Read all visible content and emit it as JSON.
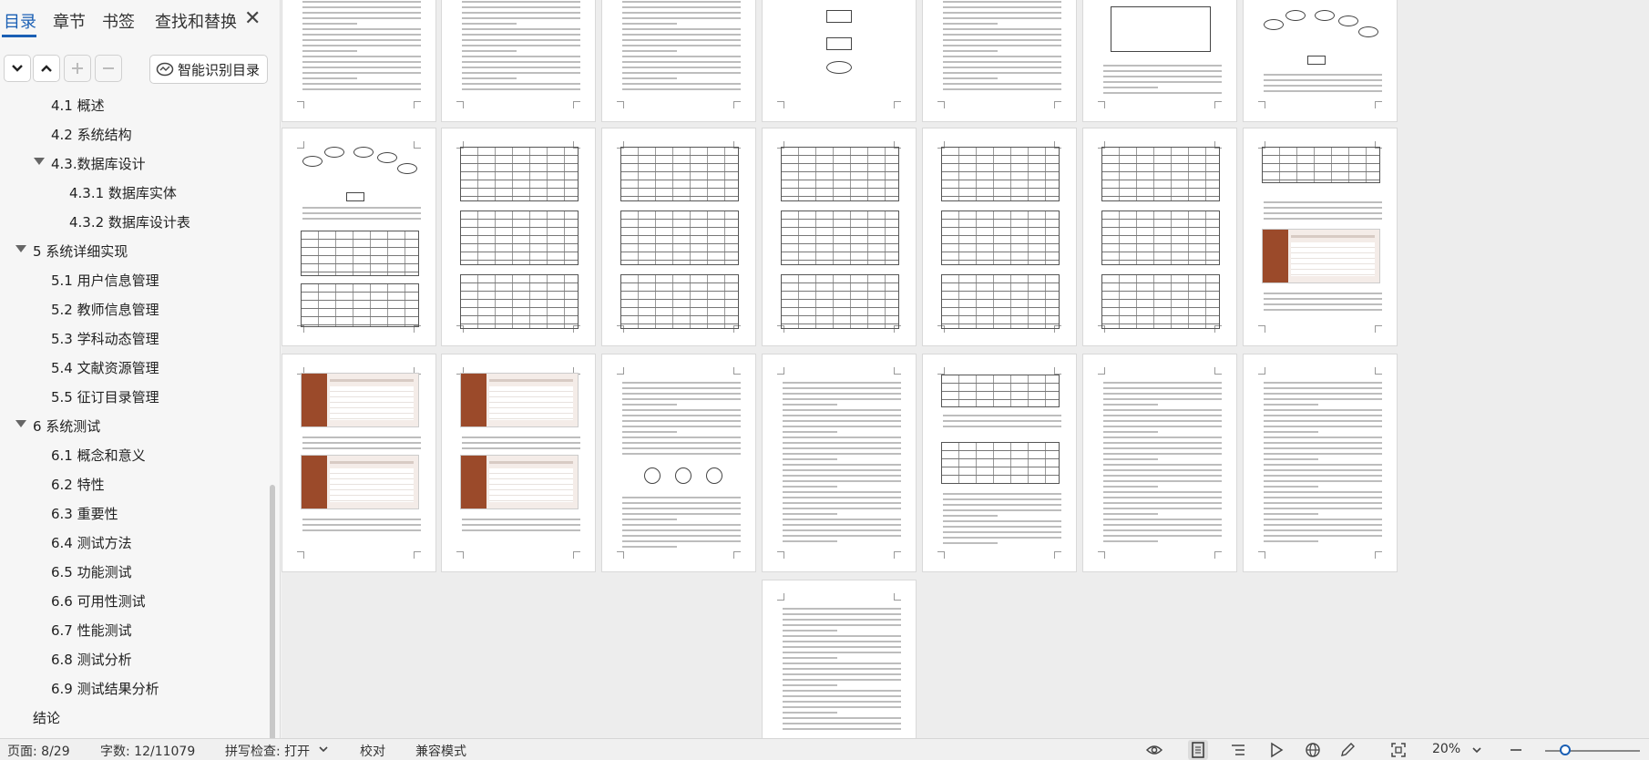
{
  "nav": {
    "tabs": [
      {
        "label": "目录"
      },
      {
        "label": "章节"
      },
      {
        "label": "书签"
      },
      {
        "label": "查找和替换"
      }
    ],
    "close_icon": "close-icon",
    "tools": {
      "expand_icon": "chevron-down-icon",
      "collapse_icon": "chevron-up-icon",
      "add_icon": "plus-icon",
      "remove_icon": "minus-icon",
      "smart_toc_label": "智能识别目录"
    },
    "toc": [
      {
        "label": "4.1 概述"
      },
      {
        "label": "4.2 系统结构"
      },
      {
        "label": "4.3.数据库设计"
      },
      {
        "label": "4.3.1 数据库实体"
      },
      {
        "label": "4.3.2 数据库设计表"
      },
      {
        "label": "5 系统详细实现"
      },
      {
        "label": "5.1  用户信息管理"
      },
      {
        "label": "5.2  教师信息管理"
      },
      {
        "label": "5.3  学科动态管理"
      },
      {
        "label": "5.4  文献资源管理"
      },
      {
        "label": "5.5  征订目录管理"
      },
      {
        "label": "6 系统测试"
      },
      {
        "label": "6.1 概念和意义"
      },
      {
        "label": "6.2 特性"
      },
      {
        "label": "6.3 重要性"
      },
      {
        "label": "6.4 测试方法"
      },
      {
        "label": "6.5  功能测试"
      },
      {
        "label": "6.6 可用性测试"
      },
      {
        "label": "6.7 性能测试"
      },
      {
        "label": "6.8 测试分析"
      },
      {
        "label": "6.9 测试结果分析"
      },
      {
        "label": "结论"
      }
    ]
  },
  "status": {
    "page": "页面: 8/29",
    "words": "字数: 12/11079",
    "spell": "拼写检查: 打开",
    "proof": "校对",
    "compat": "兼容模式",
    "zoom": "20%",
    "icons": [
      "eye-icon",
      "page-view-icon",
      "outline-icon",
      "play-icon",
      "globe-icon",
      "pen-icon",
      "fit-page-icon"
    ]
  }
}
